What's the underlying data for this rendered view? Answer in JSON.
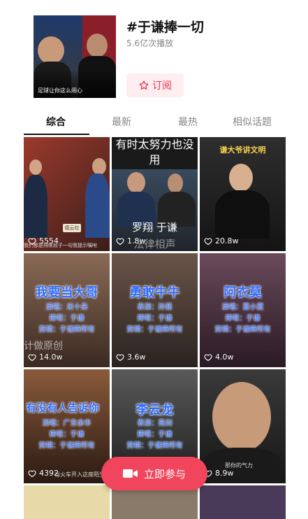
{
  "header": {
    "cover_caption": "足球让你这么闹心",
    "title": "#于谦捧一切",
    "plays": "5.6亿次播放",
    "subscribe_label": "订阅"
  },
  "tabs": [
    "综合",
    "最新",
    "最热",
    "相似话题"
  ],
  "grid": {
    "tiles": [
      {
        "likes": "5554",
        "overlay": "德云社",
        "bottom_caption": "我们都是排练段子一句我提示嘱咐"
      },
      {
        "likes": "1.8w",
        "top_text": "有时太努力也没用",
        "names": "罗翔 于谦",
        "bottom_caption": "法律相声"
      },
      {
        "likes": "20.8w",
        "top_text": "谦大爷讲文明"
      },
      {
        "likes": "14.0w",
        "headline": "我要当大哥",
        "credits": [
          "演唱：米十朵",
          "捧哏：于谦",
          "剪辑：于谦捧所有"
        ],
        "bottom_caption": "计做原创"
      },
      {
        "likes": "3.6w",
        "headline": "勇敢牛牛",
        "credits": [
          "表演：孙茹",
          "捧哏：于谦",
          "剪辑：于谦捧所有"
        ]
      },
      {
        "likes": "4.0w",
        "headline": "阿衣莫",
        "credits": [
          "演唱：夏小夏",
          "捧哏：于谦",
          "剪辑：于谦捧所有"
        ]
      },
      {
        "likes": "4392",
        "headline": "有没有人告诉你",
        "credits": [
          "演唱：广东余丰",
          "捧哏：于谦",
          "剪辑：于谦捧所有"
        ],
        "bottom_caption": "当火车开入这座陌生的城"
      },
      {
        "likes": "",
        "headline": "李云龙",
        "credits": [
          "表演：亮剑",
          "捧哏：于谦",
          "剪辑：于谦捧所有"
        ]
      },
      {
        "likes": "8.9w",
        "bottom_caption": "那你的气力"
      }
    ]
  },
  "join_button": "立即参与",
  "colors": {
    "accent": "#f0455c",
    "link_blue": "#2f6bff"
  }
}
